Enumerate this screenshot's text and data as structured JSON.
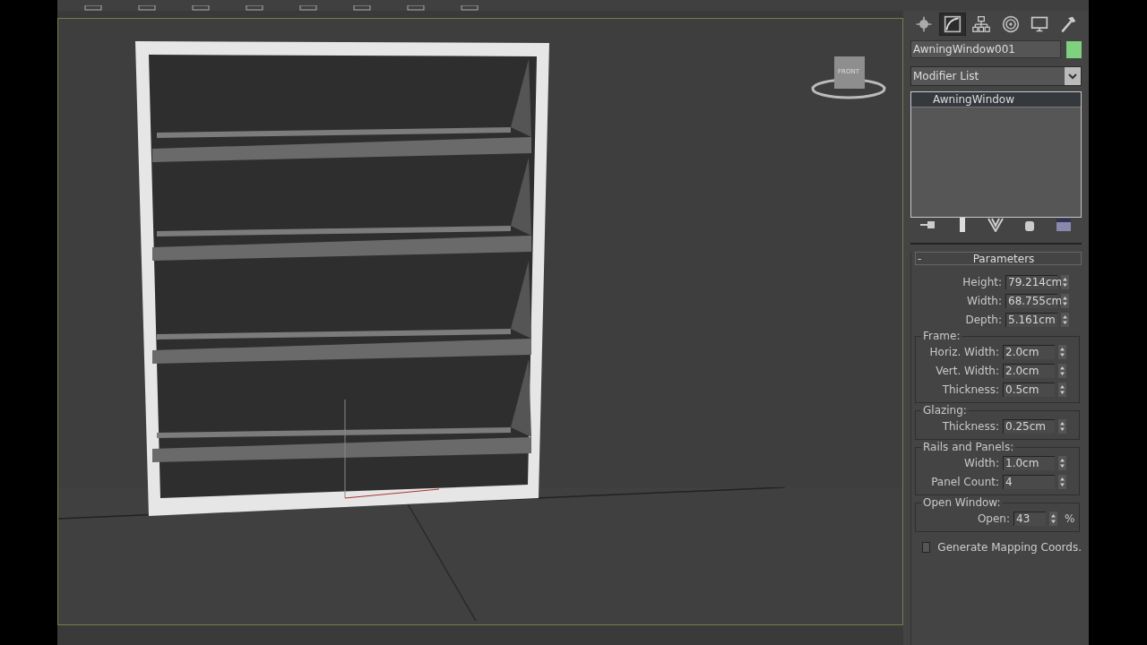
{
  "viewport": {
    "viewcube_label": "FRONT"
  },
  "command_panel": {
    "tabs": [
      {
        "selected": false
      },
      {
        "selected": true
      },
      {
        "selected": false
      },
      {
        "selected": false
      },
      {
        "selected": false
      },
      {
        "selected": false
      }
    ],
    "object_name": "AwningWindow001",
    "modifier_list": "Modifier List",
    "modifier_stack": [
      {
        "label": "AwningWindow",
        "selected": true
      }
    ],
    "rollout": {
      "toggle": "-",
      "title": "Parameters",
      "fields": [
        {
          "label": "Height:",
          "value": "79.214cm"
        },
        {
          "label": "Width:",
          "value": "68.755cm"
        },
        {
          "label": "Depth:",
          "value": "5.161cm"
        }
      ],
      "groups": [
        {
          "title": "Frame:",
          "fields": [
            {
              "label": "Horiz. Width:",
              "value": "2.0cm"
            },
            {
              "label": "Vert. Width:",
              "value": "2.0cm"
            },
            {
              "label": "Thickness:",
              "value": "0.5cm"
            }
          ]
        },
        {
          "title": "Glazing:",
          "fields": [
            {
              "label": "Thickness:",
              "value": "0.25cm"
            }
          ]
        },
        {
          "title": "Rails and Panels:",
          "fields": [
            {
              "label": "Width:",
              "value": "1.0cm"
            },
            {
              "label": "Panel Count:",
              "value": "4"
            }
          ]
        },
        {
          "title": "Open Window:",
          "fields": [
            {
              "label": "Open:",
              "value": "43",
              "unit": "%"
            }
          ]
        }
      ],
      "generate_mapping": {
        "label": "Generate Mapping Coords.",
        "checked": false
      }
    }
  }
}
